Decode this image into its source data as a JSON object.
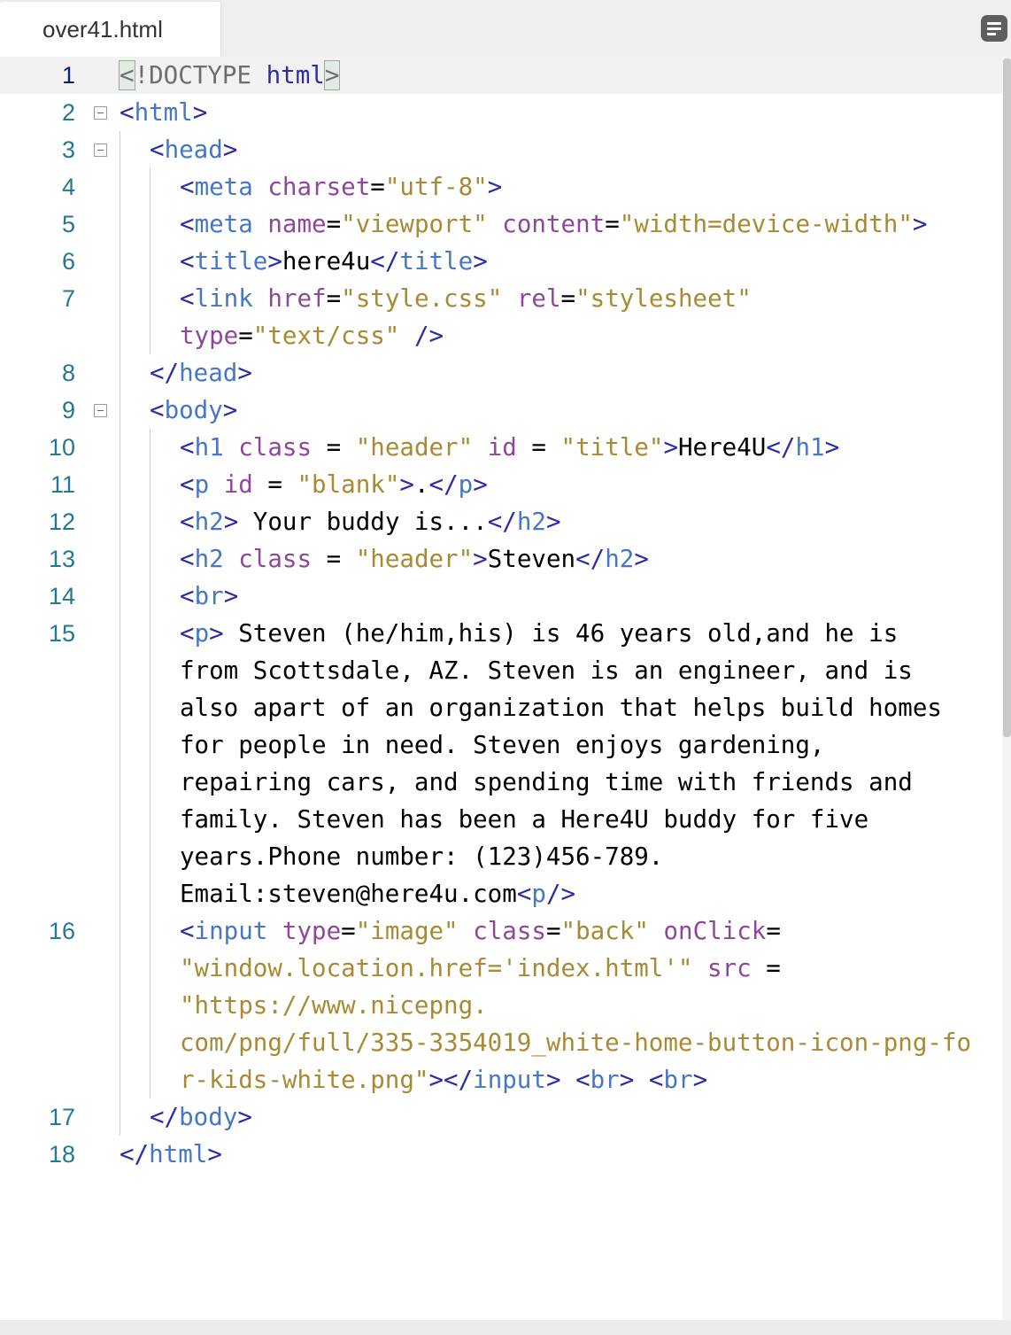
{
  "tab": {
    "filename": "over41.html"
  },
  "toolbar": {
    "menu_icon": "document-menu-icon"
  },
  "colors": {
    "tag": "#2c2ca6",
    "tag_name": "#4677c6",
    "attribute": "#8f469b",
    "string": "#a98a33",
    "line_number": "#237893",
    "active_line_number": "#0b216f",
    "active_line_bg": "#f2f2f2"
  },
  "editor": {
    "active_line": 1,
    "folded_lines": [
      2,
      3,
      9
    ],
    "lines": [
      {
        "n": "1",
        "tokens": [
          [
            "dt",
            "<!DOCTYPE html>"
          ]
        ]
      },
      {
        "n": "2",
        "tokens": [
          [
            "tg",
            "<"
          ],
          [
            "tn",
            "html"
          ],
          [
            "tg",
            ">"
          ]
        ]
      },
      {
        "n": "3",
        "tokens": [
          [
            "tg",
            "<"
          ],
          [
            "tn",
            "head"
          ],
          [
            "tg",
            ">"
          ]
        ]
      },
      {
        "n": "4",
        "tokens": [
          [
            "tg",
            "<"
          ],
          [
            "tn",
            "meta"
          ],
          [
            "tx",
            " "
          ],
          [
            "at",
            "charset"
          ],
          [
            "tx",
            "="
          ],
          [
            "st",
            "\"utf-8\""
          ],
          [
            "tg",
            ">"
          ]
        ]
      },
      {
        "n": "5",
        "tokens": [
          [
            "tg",
            "<"
          ],
          [
            "tn",
            "meta"
          ],
          [
            "tx",
            " "
          ],
          [
            "at",
            "name"
          ],
          [
            "tx",
            "="
          ],
          [
            "st",
            "\"viewport\""
          ],
          [
            "tx",
            " "
          ],
          [
            "at",
            "content"
          ],
          [
            "tx",
            "="
          ],
          [
            "st",
            "\"width=device-width\""
          ],
          [
            "tg",
            ">"
          ]
        ]
      },
      {
        "n": "6",
        "tokens": [
          [
            "tg",
            "<"
          ],
          [
            "tn",
            "title"
          ],
          [
            "tg",
            ">"
          ],
          [
            "tx",
            "here4u"
          ],
          [
            "tg",
            "</"
          ],
          [
            "tn",
            "title"
          ],
          [
            "tg",
            ">"
          ]
        ]
      },
      {
        "n": "7",
        "tokens": [
          [
            "tg",
            "<"
          ],
          [
            "tn",
            "link"
          ],
          [
            "tx",
            " "
          ],
          [
            "at",
            "href"
          ],
          [
            "tx",
            "="
          ],
          [
            "st",
            "\"style.css\""
          ],
          [
            "tx",
            " "
          ],
          [
            "at",
            "rel"
          ],
          [
            "tx",
            "="
          ],
          [
            "st",
            "\"stylesheet\""
          ]
        ]
      },
      {
        "n": "",
        "tokens": [
          [
            "at",
            "type"
          ],
          [
            "tx",
            "="
          ],
          [
            "st",
            "\"text/css\""
          ],
          [
            "tx",
            " "
          ],
          [
            "tg",
            "/>"
          ]
        ]
      },
      {
        "n": "8",
        "tokens": [
          [
            "tg",
            "</"
          ],
          [
            "tn",
            "head"
          ],
          [
            "tg",
            ">"
          ]
        ]
      },
      {
        "n": "9",
        "tokens": [
          [
            "tg",
            "<"
          ],
          [
            "tn",
            "body"
          ],
          [
            "tg",
            ">"
          ]
        ]
      },
      {
        "n": "10",
        "tokens": [
          [
            "tg",
            "<"
          ],
          [
            "tn",
            "h1"
          ],
          [
            "tx",
            " "
          ],
          [
            "at",
            "class"
          ],
          [
            "tx",
            " = "
          ],
          [
            "st",
            "\"header\""
          ],
          [
            "tx",
            " "
          ],
          [
            "at",
            "id"
          ],
          [
            "tx",
            " = "
          ],
          [
            "st",
            "\"title\""
          ],
          [
            "tg",
            ">"
          ],
          [
            "tx",
            "Here4U"
          ],
          [
            "tg",
            "</"
          ],
          [
            "tn",
            "h1"
          ],
          [
            "tg",
            ">"
          ]
        ]
      },
      {
        "n": "11",
        "tokens": [
          [
            "tg",
            "<"
          ],
          [
            "tn",
            "p"
          ],
          [
            "tx",
            " "
          ],
          [
            "at",
            "id"
          ],
          [
            "tx",
            " = "
          ],
          [
            "st",
            "\"blank\""
          ],
          [
            "tg",
            ">"
          ],
          [
            "tx",
            "."
          ],
          [
            "tg",
            "</"
          ],
          [
            "tn",
            "p"
          ],
          [
            "tg",
            ">"
          ]
        ]
      },
      {
        "n": "12",
        "tokens": [
          [
            "tg",
            "<"
          ],
          [
            "tn",
            "h2"
          ],
          [
            "tg",
            ">"
          ],
          [
            "tx",
            " Your buddy is..."
          ],
          [
            "tg",
            "</"
          ],
          [
            "tn",
            "h2"
          ],
          [
            "tg",
            ">"
          ]
        ]
      },
      {
        "n": "13",
        "tokens": [
          [
            "tg",
            "<"
          ],
          [
            "tn",
            "h2"
          ],
          [
            "tx",
            " "
          ],
          [
            "at",
            "class"
          ],
          [
            "tx",
            " = "
          ],
          [
            "st",
            "\"header\""
          ],
          [
            "tg",
            ">"
          ],
          [
            "tx",
            "Steven"
          ],
          [
            "tg",
            "</"
          ],
          [
            "tn",
            "h2"
          ],
          [
            "tg",
            ">"
          ]
        ]
      },
      {
        "n": "14",
        "tokens": [
          [
            "tg",
            "<"
          ],
          [
            "tn",
            "br"
          ],
          [
            "tg",
            ">"
          ]
        ]
      },
      {
        "n": "15",
        "tokens": [
          [
            "tg",
            "<"
          ],
          [
            "tn",
            "p"
          ],
          [
            "tg",
            ">"
          ],
          [
            "tx",
            " Steven (he/him,his) is 46 years old,and he is"
          ]
        ]
      },
      {
        "n": "",
        "tokens": [
          [
            "tx",
            "from Scottsdale, AZ. Steven is an engineer, and is"
          ]
        ]
      },
      {
        "n": "",
        "tokens": [
          [
            "tx",
            "also apart of an organization that helps build homes"
          ]
        ]
      },
      {
        "n": "",
        "tokens": [
          [
            "tx",
            "for people in need. Steven enjoys gardening,"
          ]
        ]
      },
      {
        "n": "",
        "tokens": [
          [
            "tx",
            "repairing cars, and spending time with friends and"
          ]
        ]
      },
      {
        "n": "",
        "tokens": [
          [
            "tx",
            "family. Steven has been a Here4U buddy for five"
          ]
        ]
      },
      {
        "n": "",
        "tokens": [
          [
            "tx",
            "years.Phone number: (123)456-789."
          ]
        ]
      },
      {
        "n": "",
        "tokens": [
          [
            "tx",
            "Email:steven@here4u.com"
          ],
          [
            "tg",
            "<"
          ],
          [
            "tn",
            "p"
          ],
          [
            "tg",
            "/>"
          ]
        ]
      },
      {
        "n": "16",
        "tokens": [
          [
            "tg",
            "<"
          ],
          [
            "tn",
            "input"
          ],
          [
            "tx",
            " "
          ],
          [
            "at",
            "type"
          ],
          [
            "tx",
            "="
          ],
          [
            "st",
            "\"image\""
          ],
          [
            "tx",
            " "
          ],
          [
            "at",
            "class"
          ],
          [
            "tx",
            "="
          ],
          [
            "st",
            "\"back\""
          ],
          [
            "tx",
            " "
          ],
          [
            "at",
            "onClick"
          ],
          [
            "tx",
            "="
          ]
        ]
      },
      {
        "n": "",
        "tokens": [
          [
            "st",
            "\"window.location.href='index.html'\""
          ],
          [
            "tx",
            " "
          ],
          [
            "at",
            "src"
          ],
          [
            "tx",
            " ="
          ]
        ]
      },
      {
        "n": "",
        "tokens": [
          [
            "st",
            "\"https://www.nicepng."
          ]
        ]
      },
      {
        "n": "",
        "tokens": [
          [
            "st",
            "com/png/full/335-3354019_white-home-button-icon-png-fo"
          ]
        ]
      },
      {
        "n": "",
        "tokens": [
          [
            "st",
            "r-kids-white.png\""
          ],
          [
            "tg",
            "></"
          ],
          [
            "tn",
            "input"
          ],
          [
            "tg",
            ">"
          ],
          [
            "tx",
            " "
          ],
          [
            "tg",
            "<"
          ],
          [
            "tn",
            "br"
          ],
          [
            "tg",
            ">"
          ],
          [
            "tx",
            " "
          ],
          [
            "tg",
            "<"
          ],
          [
            "tn",
            "br"
          ],
          [
            "tg",
            ">"
          ]
        ]
      },
      {
        "n": "17",
        "tokens": [
          [
            "tg",
            "</"
          ],
          [
            "tn",
            "body"
          ],
          [
            "tg",
            ">"
          ]
        ]
      },
      {
        "n": "18",
        "tokens": [
          [
            "tg",
            "</"
          ],
          [
            "tn",
            "html"
          ],
          [
            "tg",
            ">"
          ]
        ]
      }
    ]
  }
}
